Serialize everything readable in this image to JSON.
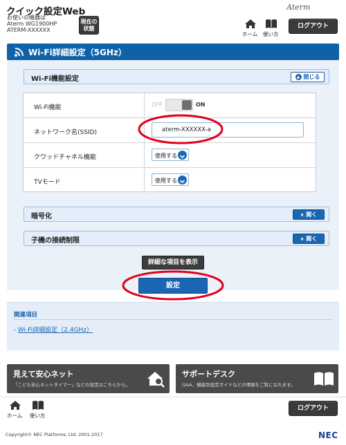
{
  "header": {
    "title": "クイック設定Web",
    "device_line1": "お使いの機器は",
    "device_line2": "Aterm WG1900HP",
    "device_line3": "ATERM-XXXXXX",
    "status_button_line1": "現在の",
    "status_button_line2": "状態",
    "brand": "Aterm",
    "home_label": "ホーム",
    "help_label": "使い方",
    "logout_label": "ログアウト"
  },
  "page": {
    "title": "Wi-Fi詳細設定（5GHz）"
  },
  "sections": {
    "wifi_function": {
      "title": "Wi-Fi機能設定",
      "toggle_label": "閉じる"
    },
    "encryption": {
      "title": "暗号化",
      "toggle_label": "開く"
    },
    "client_limit": {
      "title": "子機の接続制限",
      "toggle_label": "開く"
    }
  },
  "settings": {
    "wifi": {
      "label": "Wi-Fi機能",
      "off_label": "OFF",
      "on_label": "ON",
      "value": "ON"
    },
    "ssid": {
      "label": "ネットワーク名(SSID)",
      "value": "aterm-XXXXXX-a"
    },
    "quad_channel": {
      "label": "クワッドチャネル機能",
      "value": "使用する"
    },
    "tv_mode": {
      "label": "TVモード",
      "value": "使用する"
    }
  },
  "actions": {
    "show_details_label": "詳細な項目を表示",
    "apply_label": "設定"
  },
  "related": {
    "title": "関連項目",
    "links": [
      "Wi-Fi詳細設定（2.4GHz）"
    ]
  },
  "banners": {
    "safety_net": {
      "title": "見えて安心ネット",
      "subtitle": "「こども安心ネットタイマー」などの設定はこちらから。"
    },
    "support_desk": {
      "title": "サポートデスク",
      "subtitle": "Q&A、機能別設定ガイドなどの情報をご覧になれます。"
    }
  },
  "footer": {
    "home_label": "ホーム",
    "help_label": "使い方",
    "logout_label": "ログアウト",
    "copyright": "Copyright© NEC Platforms, Ltd. 2001-2017",
    "logo": "NEC"
  },
  "colors": {
    "primary_blue": "#0f62a8",
    "annotation_red": "#e0001b",
    "dark_button": "#3a3a3a"
  }
}
